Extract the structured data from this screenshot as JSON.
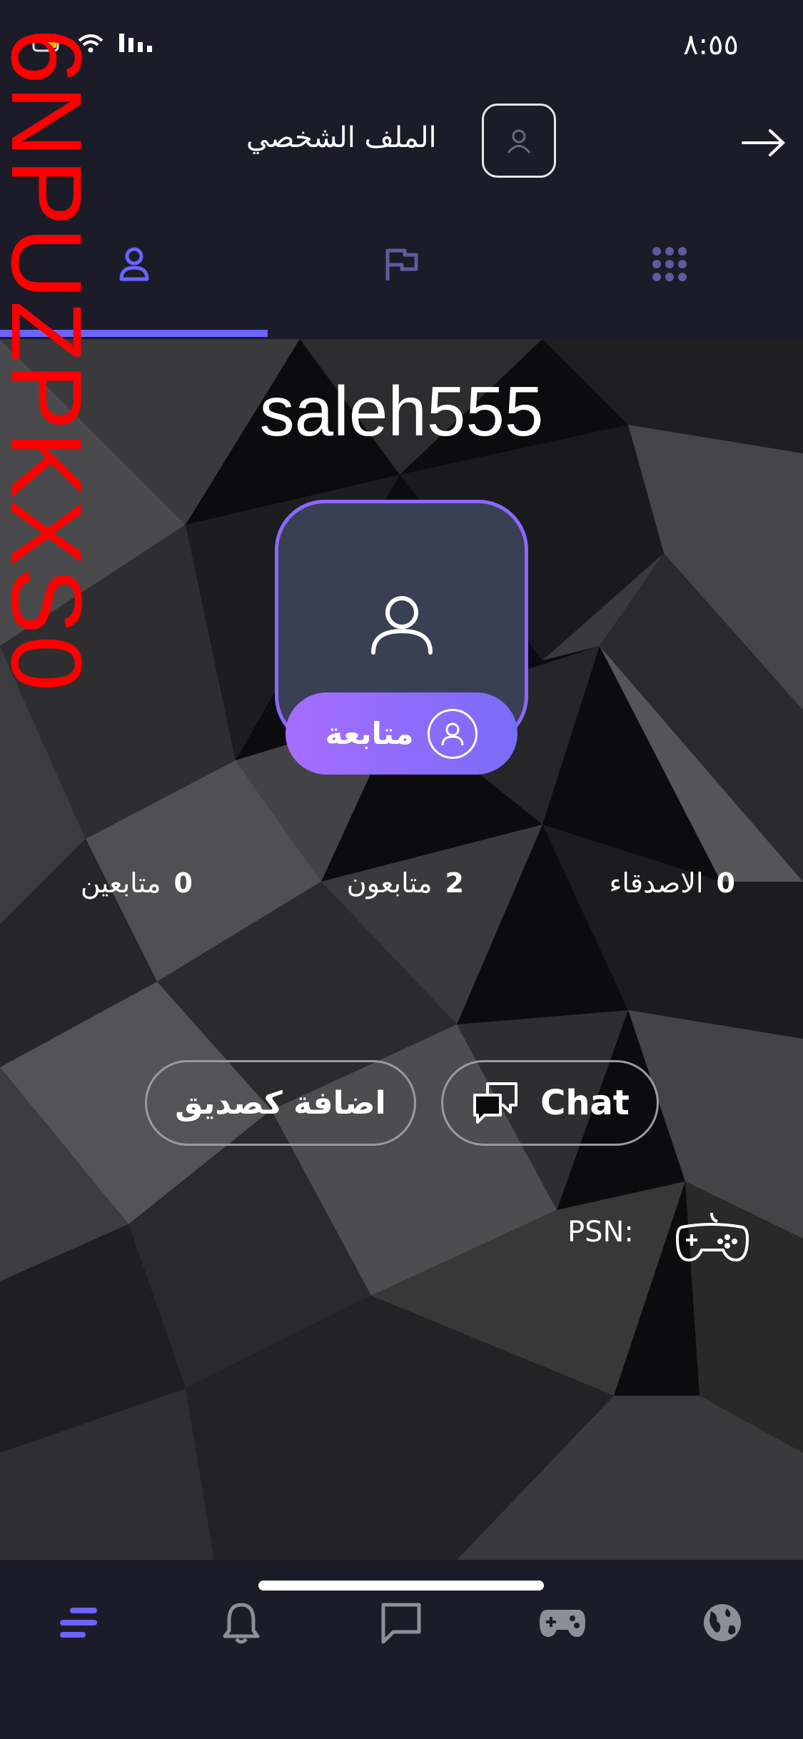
{
  "status_bar": {
    "time": "٨:٥٥"
  },
  "watermark": "6NPUZPKXS0",
  "header": {
    "title": "الملف الشخصي",
    "menu": "···"
  },
  "tabs": [
    {
      "name": "profile",
      "icon": "person-icon",
      "active": true
    },
    {
      "name": "flags",
      "icon": "flag-icon",
      "active": false
    },
    {
      "name": "grid",
      "icon": "grid-icon",
      "active": false
    }
  ],
  "profile": {
    "username": "saleh555",
    "follow_label": "متابعة"
  },
  "stats": {
    "friends": {
      "count": "0",
      "label": "الاصدقاء"
    },
    "followers": {
      "count": "2",
      "label": "متابعون"
    },
    "following": {
      "count": "0",
      "label": "متابعين"
    }
  },
  "actions": {
    "add_friend_label": "اضافة كصديق",
    "chat_label": "Chat"
  },
  "psn": {
    "label": "PSN:"
  },
  "bottom_nav": [
    {
      "name": "menu",
      "icon": "menu-icon",
      "active": true
    },
    {
      "name": "notifications",
      "icon": "bell-icon",
      "active": false
    },
    {
      "name": "messages",
      "icon": "chat-icon",
      "active": false
    },
    {
      "name": "games",
      "icon": "gamepad-icon",
      "active": false
    },
    {
      "name": "explore",
      "icon": "globe-icon",
      "active": false
    }
  ],
  "colors": {
    "accent": "#6c63ff",
    "background": "#1b1c28",
    "follow_gradient_start": "#a66cff",
    "follow_gradient_end": "#7a6cf8"
  }
}
